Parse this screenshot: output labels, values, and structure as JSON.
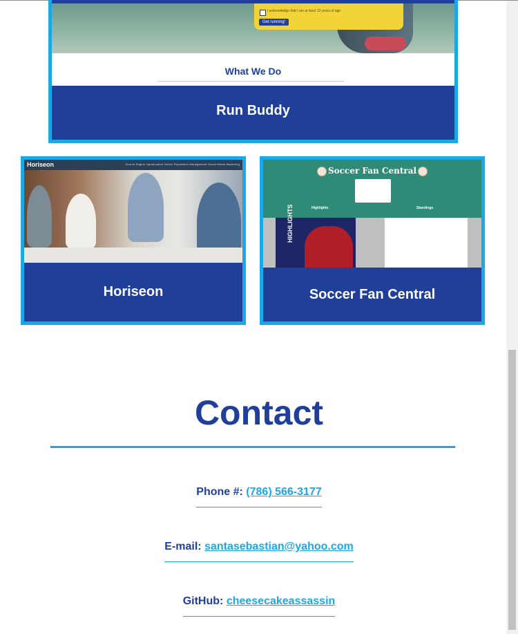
{
  "projects": [
    {
      "title": "Run Buddy",
      "preview": {
        "acknowledge_text": "I acknowledge that I am at least 13 years of age",
        "cta_label": "Get running!",
        "section_heading": "What We Do"
      }
    },
    {
      "title": "Horiseon",
      "preview": {
        "logo": "Horiseon",
        "nav_links": "Search Engine Optimization    Online Reputation Management    Social Media Marketing"
      }
    },
    {
      "title": "Soccer Fan Central",
      "preview": {
        "site_title": "Soccer Fan Central",
        "highlights_label": "Highlights",
        "standings_label": "Standings",
        "video_text": "HIGHLIGHTS"
      }
    }
  ],
  "contact": {
    "heading": "Contact",
    "phone_label": "Phone #:",
    "phone_value": "(786) 566-3177",
    "email_label": "E-mail:",
    "email_value": "santasebastian@yahoo.com",
    "github_label": "GitHub:",
    "github_value": "cheesecakeassassin"
  },
  "colors": {
    "accent": "#1aa9e8",
    "brand": "#1f3f98"
  }
}
